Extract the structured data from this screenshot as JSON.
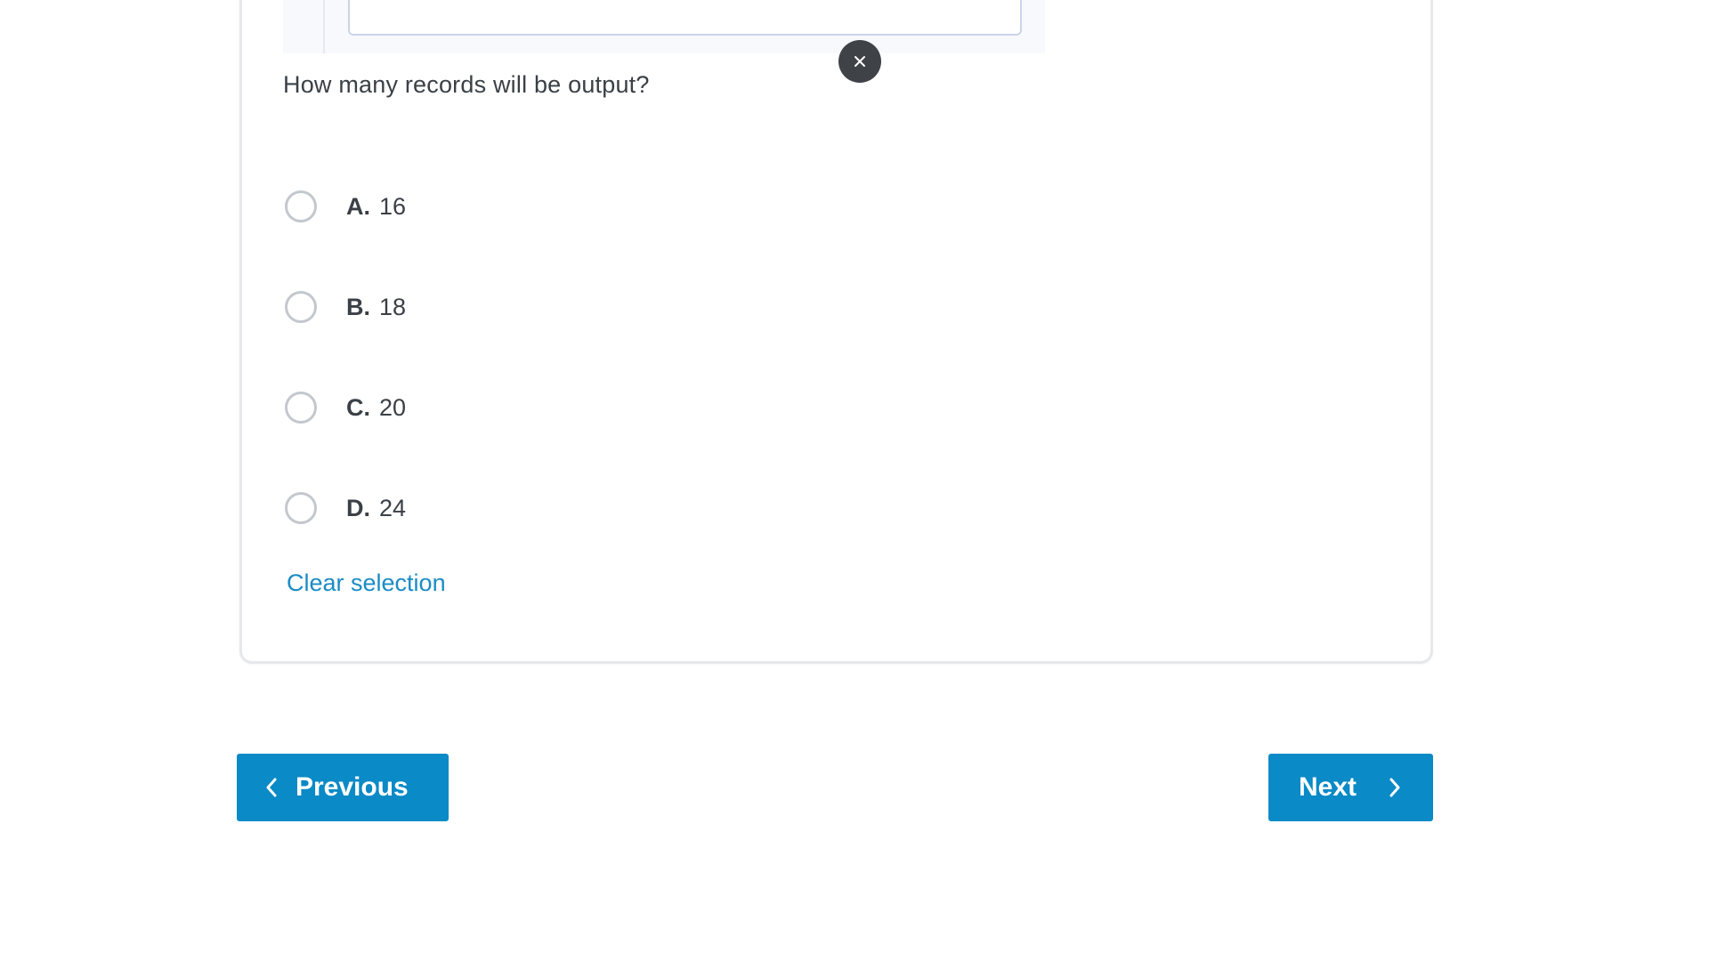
{
  "question": {
    "text": "How many records will be output?",
    "options": [
      {
        "letter": "A.",
        "text": "16"
      },
      {
        "letter": "B.",
        "text": "18"
      },
      {
        "letter": "C.",
        "text": "20"
      },
      {
        "letter": "D.",
        "text": "24"
      }
    ],
    "clear_label": "Clear selection"
  },
  "image_close": {
    "icon": "close-icon"
  },
  "nav": {
    "previous_label": "Previous",
    "next_label": "Next"
  },
  "colors": {
    "primary": "#0a8ac6",
    "link": "#1a8cc4",
    "text": "#3a4046",
    "close_bg": "#3f4347",
    "radio_border": "#c3c8ce"
  }
}
